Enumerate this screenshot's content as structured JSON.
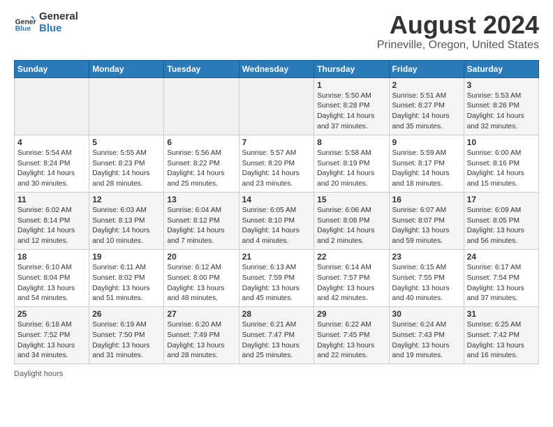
{
  "header": {
    "logo_general": "General",
    "logo_blue": "Blue",
    "title": "August 2024",
    "subtitle": "Prineville, Oregon, United States"
  },
  "calendar": {
    "days_of_week": [
      "Sunday",
      "Monday",
      "Tuesday",
      "Wednesday",
      "Thursday",
      "Friday",
      "Saturday"
    ],
    "weeks": [
      [
        {
          "day": "",
          "info": ""
        },
        {
          "day": "",
          "info": ""
        },
        {
          "day": "",
          "info": ""
        },
        {
          "day": "",
          "info": ""
        },
        {
          "day": "1",
          "info": "Sunrise: 5:50 AM\nSunset: 8:28 PM\nDaylight: 14 hours and 37 minutes."
        },
        {
          "day": "2",
          "info": "Sunrise: 5:51 AM\nSunset: 8:27 PM\nDaylight: 14 hours and 35 minutes."
        },
        {
          "day": "3",
          "info": "Sunrise: 5:53 AM\nSunset: 8:26 PM\nDaylight: 14 hours and 32 minutes."
        }
      ],
      [
        {
          "day": "4",
          "info": "Sunrise: 5:54 AM\nSunset: 8:24 PM\nDaylight: 14 hours and 30 minutes."
        },
        {
          "day": "5",
          "info": "Sunrise: 5:55 AM\nSunset: 8:23 PM\nDaylight: 14 hours and 28 minutes."
        },
        {
          "day": "6",
          "info": "Sunrise: 5:56 AM\nSunset: 8:22 PM\nDaylight: 14 hours and 25 minutes."
        },
        {
          "day": "7",
          "info": "Sunrise: 5:57 AM\nSunset: 8:20 PM\nDaylight: 14 hours and 23 minutes."
        },
        {
          "day": "8",
          "info": "Sunrise: 5:58 AM\nSunset: 8:19 PM\nDaylight: 14 hours and 20 minutes."
        },
        {
          "day": "9",
          "info": "Sunrise: 5:59 AM\nSunset: 8:17 PM\nDaylight: 14 hours and 18 minutes."
        },
        {
          "day": "10",
          "info": "Sunrise: 6:00 AM\nSunset: 8:16 PM\nDaylight: 14 hours and 15 minutes."
        }
      ],
      [
        {
          "day": "11",
          "info": "Sunrise: 6:02 AM\nSunset: 8:14 PM\nDaylight: 14 hours and 12 minutes."
        },
        {
          "day": "12",
          "info": "Sunrise: 6:03 AM\nSunset: 8:13 PM\nDaylight: 14 hours and 10 minutes."
        },
        {
          "day": "13",
          "info": "Sunrise: 6:04 AM\nSunset: 8:12 PM\nDaylight: 14 hours and 7 minutes."
        },
        {
          "day": "14",
          "info": "Sunrise: 6:05 AM\nSunset: 8:10 PM\nDaylight: 14 hours and 4 minutes."
        },
        {
          "day": "15",
          "info": "Sunrise: 6:06 AM\nSunset: 8:08 PM\nDaylight: 14 hours and 2 minutes."
        },
        {
          "day": "16",
          "info": "Sunrise: 6:07 AM\nSunset: 8:07 PM\nDaylight: 13 hours and 59 minutes."
        },
        {
          "day": "17",
          "info": "Sunrise: 6:09 AM\nSunset: 8:05 PM\nDaylight: 13 hours and 56 minutes."
        }
      ],
      [
        {
          "day": "18",
          "info": "Sunrise: 6:10 AM\nSunset: 8:04 PM\nDaylight: 13 hours and 54 minutes."
        },
        {
          "day": "19",
          "info": "Sunrise: 6:11 AM\nSunset: 8:02 PM\nDaylight: 13 hours and 51 minutes."
        },
        {
          "day": "20",
          "info": "Sunrise: 6:12 AM\nSunset: 8:00 PM\nDaylight: 13 hours and 48 minutes."
        },
        {
          "day": "21",
          "info": "Sunrise: 6:13 AM\nSunset: 7:59 PM\nDaylight: 13 hours and 45 minutes."
        },
        {
          "day": "22",
          "info": "Sunrise: 6:14 AM\nSunset: 7:57 PM\nDaylight: 13 hours and 42 minutes."
        },
        {
          "day": "23",
          "info": "Sunrise: 6:15 AM\nSunset: 7:55 PM\nDaylight: 13 hours and 40 minutes."
        },
        {
          "day": "24",
          "info": "Sunrise: 6:17 AM\nSunset: 7:54 PM\nDaylight: 13 hours and 37 minutes."
        }
      ],
      [
        {
          "day": "25",
          "info": "Sunrise: 6:18 AM\nSunset: 7:52 PM\nDaylight: 13 hours and 34 minutes."
        },
        {
          "day": "26",
          "info": "Sunrise: 6:19 AM\nSunset: 7:50 PM\nDaylight: 13 hours and 31 minutes."
        },
        {
          "day": "27",
          "info": "Sunrise: 6:20 AM\nSunset: 7:49 PM\nDaylight: 13 hours and 28 minutes."
        },
        {
          "day": "28",
          "info": "Sunrise: 6:21 AM\nSunset: 7:47 PM\nDaylight: 13 hours and 25 minutes."
        },
        {
          "day": "29",
          "info": "Sunrise: 6:22 AM\nSunset: 7:45 PM\nDaylight: 13 hours and 22 minutes."
        },
        {
          "day": "30",
          "info": "Sunrise: 6:24 AM\nSunset: 7:43 PM\nDaylight: 13 hours and 19 minutes."
        },
        {
          "day": "31",
          "info": "Sunrise: 6:25 AM\nSunset: 7:42 PM\nDaylight: 13 hours and 16 minutes."
        }
      ]
    ]
  },
  "footer": {
    "note": "Daylight hours"
  }
}
